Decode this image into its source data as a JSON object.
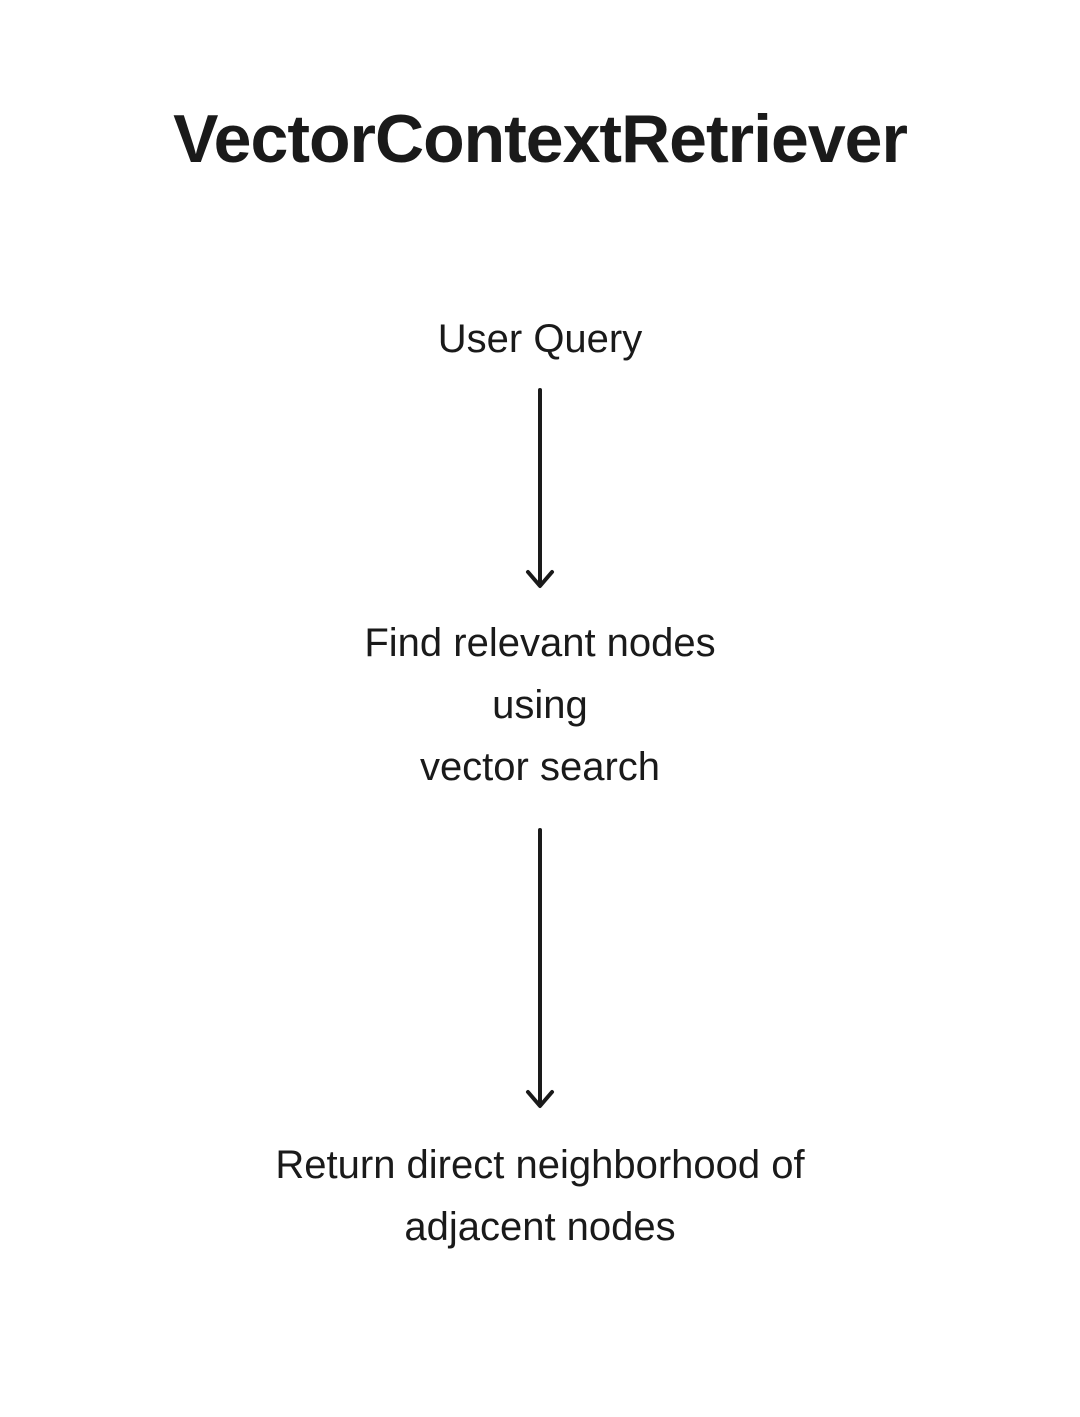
{
  "title": "VectorContextRetriever",
  "steps": {
    "step1": "User Query",
    "step2_line1": "Find relevant nodes",
    "step2_line2": "using",
    "step2_line3": "vector search",
    "step3_line1": "Return direct neighborhood of",
    "step3_line2": "adjacent nodes"
  }
}
